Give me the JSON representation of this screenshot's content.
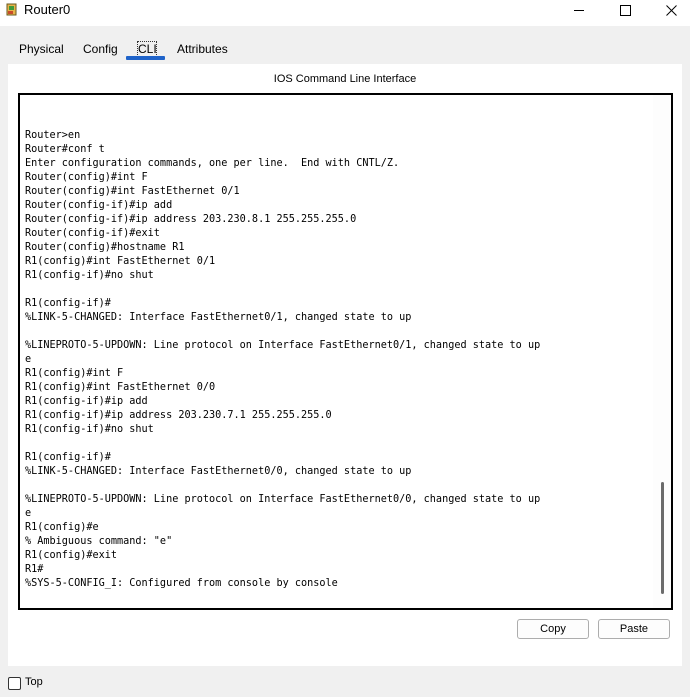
{
  "window": {
    "title": "Router0",
    "icons": {
      "app": "router-app-icon",
      "minimize": "minimize-icon",
      "maximize": "maximize-icon",
      "close": "close-icon"
    }
  },
  "tabs": [
    {
      "label": "Physical",
      "active": false
    },
    {
      "label": "Config",
      "active": false
    },
    {
      "label": "CLI",
      "active": true
    },
    {
      "label": "Attributes",
      "active": false
    }
  ],
  "cli": {
    "heading": "IOS Command Line Interface",
    "output": "Router>en\nRouter#conf t\nEnter configuration commands, one per line.  End with CNTL/Z.\nRouter(config)#int F\nRouter(config)#int FastEthernet 0/1\nRouter(config-if)#ip add\nRouter(config-if)#ip address 203.230.8.1 255.255.255.0\nRouter(config-if)#exit\nRouter(config)#hostname R1\nR1(config)#int FastEthernet 0/1\nR1(config-if)#no shut\n\nR1(config-if)#\n%LINK-5-CHANGED: Interface FastEthernet0/1, changed state to up\n\n%LINEPROTO-5-UPDOWN: Line protocol on Interface FastEthernet0/1, changed state to up\ne\nR1(config)#int F\nR1(config)#int FastEthernet 0/0\nR1(config-if)#ip add\nR1(config-if)#ip address 203.230.7.1 255.255.255.0\nR1(config-if)#no shut\n\nR1(config-if)#\n%LINK-5-CHANGED: Interface FastEthernet0/0, changed state to up\n\n%LINEPROTO-5-UPDOWN: Line protocol on Interface FastEthernet0/0, changed state to up\ne\nR1(config)#e\n% Ambiguous command: \"e\"\nR1(config)#exit\nR1#\n%SYS-5-CONFIG_I: Configured from console by console",
    "copy_label": "Copy",
    "paste_label": "Paste"
  },
  "footer": {
    "top_label": "Top",
    "top_checked": false
  },
  "colors": {
    "accent": "#1f63c9",
    "background": "#f0f0f0"
  }
}
